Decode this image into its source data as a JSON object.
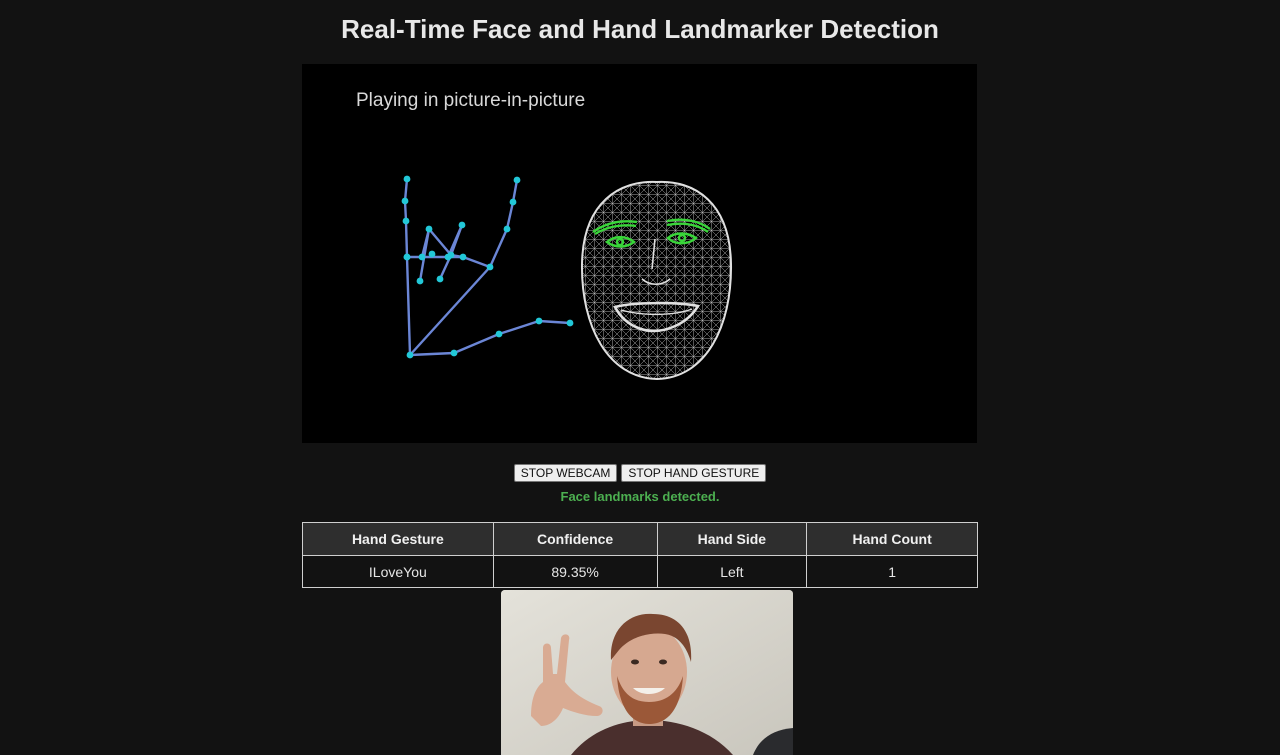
{
  "page": {
    "title": "Real-Time Face and Hand Landmarker Detection"
  },
  "video": {
    "pip_message": "Playing in picture-in-picture"
  },
  "controls": {
    "stop_webcam_label": "STOP WEBCAM",
    "stop_gesture_label": "STOP HAND GESTURE"
  },
  "status": {
    "message": "Face landmarks detected.",
    "color": "#4caf50"
  },
  "results_table": {
    "headers": [
      "Hand Gesture",
      "Confidence",
      "Hand Side",
      "Hand Count"
    ],
    "rows": [
      [
        "ILoveYou",
        "89.35%",
        "Left",
        "1"
      ]
    ]
  },
  "overlay_colors": {
    "hand_connections": "#6b86d6",
    "hand_landmarks": "#22c8d8",
    "face_mesh": "#e0e0e0",
    "eyes_and_brows": "#39d639"
  }
}
